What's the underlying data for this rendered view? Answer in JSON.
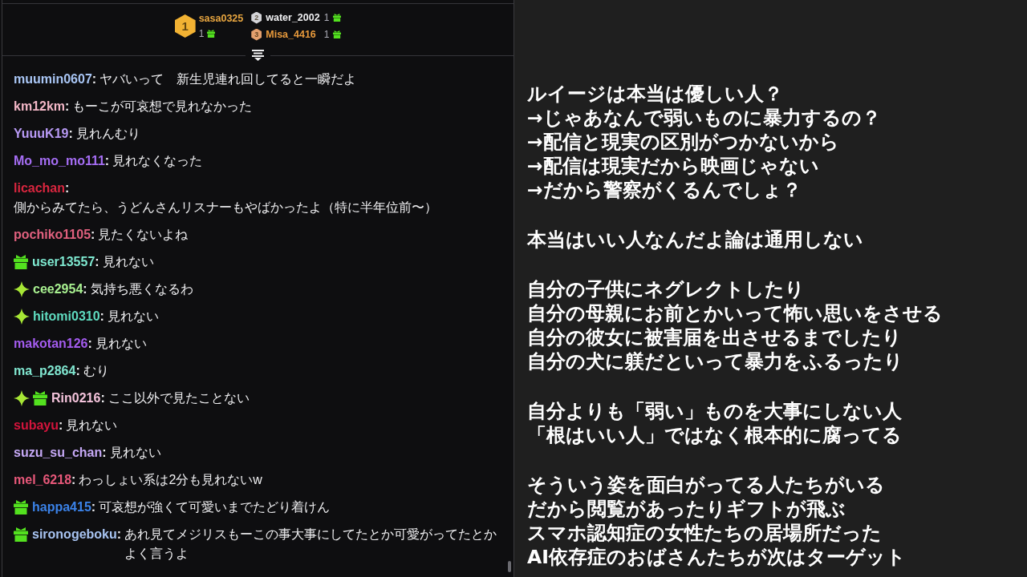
{
  "leaderboard": [
    {
      "kind": "featured",
      "medal": {
        "rank": "1",
        "color": "#f2b233"
      },
      "user": {
        "name": "sasa0325",
        "color": "#e8a640"
      },
      "count": "1"
    },
    {
      "kind": "compact",
      "medal": {
        "rank": "2",
        "color": "#d4d4d8"
      },
      "user": {
        "name": "water_2002",
        "color": "#efeff1"
      },
      "count": "1"
    },
    {
      "kind": "compact",
      "medal": {
        "rank": "3",
        "color": "#e3a06e"
      },
      "user": {
        "name": "Misa_4416",
        "color": "#e89a3c"
      },
      "count": "1"
    }
  ],
  "chat": [
    {
      "user": "muumin0607",
      "color": "#a9c6f5",
      "sep": ":",
      "kind": "inline",
      "message": "ヤバいって　新生児連れ回してると一瞬だよ"
    },
    {
      "user": "km12km",
      "color": "#f4b8c8",
      "sep": ":",
      "kind": "inline",
      "message": "もーこが可哀想で見れなかった"
    },
    {
      "user": "YuuuK19",
      "color": "#b89af5",
      "sep": ":",
      "kind": "inline",
      "message": "見れんむり"
    },
    {
      "user": "Mo_mo_mo111",
      "color": "#a66ef5",
      "sep": ":",
      "kind": "inline",
      "message": "見れなくなった"
    },
    {
      "user": "licachan",
      "color": "#d9263f",
      "sep": ":",
      "kind": "block",
      "message": "側からみてたら、うどんさんリスナーもやばかったよ（特に半年位前〜）"
    },
    {
      "user": "pochiko1105",
      "color": "#e0607e",
      "sep": ":",
      "kind": "inline",
      "message": "見たくないよね"
    },
    {
      "user": "user13557",
      "color": "#7ee8d0",
      "sep": ":",
      "kind": "inline",
      "badges": [
        {
          "kind": "gift"
        }
      ],
      "message": "見れない"
    },
    {
      "user": "cee2954",
      "color": "#a8f090",
      "sep": ":",
      "kind": "inline",
      "badges": [
        {
          "kind": "sparkle"
        }
      ],
      "message": "気持ち悪くなるわ"
    },
    {
      "user": "hitomi0310",
      "color": "#5fdcc0",
      "sep": ":",
      "kind": "inline",
      "badges": [
        {
          "kind": "sparkle"
        }
      ],
      "message": "見れない"
    },
    {
      "user": "makotan126",
      "color": "#a45cf0",
      "sep": ":",
      "kind": "inline",
      "message": "見れない"
    },
    {
      "user": "ma_p2864",
      "color": "#80e6d0",
      "sep": ":",
      "kind": "inline",
      "message": "むり"
    },
    {
      "user": "Rin0216",
      "color": "#f5c4dc",
      "sep": ":",
      "kind": "inline",
      "badges": [
        {
          "kind": "sparkle"
        },
        {
          "kind": "gift"
        }
      ],
      "message": "ここ以外で見たことない"
    },
    {
      "user": "subayu",
      "color": "#d4143c",
      "sep": ":",
      "kind": "inline",
      "message": "見れない"
    },
    {
      "user": "suzu_su_chan",
      "color": "#c5a8f5",
      "sep": ":",
      "kind": "inline",
      "message": "見れない"
    },
    {
      "user": "mel_6218",
      "color": "#e8587a",
      "sep": ":",
      "kind": "inline",
      "message": "わっしょい系は2分も見れないw"
    },
    {
      "user": "happa415",
      "color": "#3b82e8",
      "sep": ":",
      "kind": "inline",
      "badges": [
        {
          "kind": "gift"
        }
      ],
      "message": "可哀想が強くて可愛いまでたどり着けん"
    },
    {
      "user": "sironogeboku",
      "color": "#a8c4f2",
      "sep": ":",
      "kind": "inline",
      "badges": [
        {
          "kind": "gift"
        }
      ],
      "message": "あれ見てメジリスもーこの事大事にしてたとか可愛がってたとかよく言うよ"
    }
  ],
  "notes": {
    "paragraphs": [
      {
        "lines": [
          "ルイージは本当は優しい人？",
          "→じゃあなんで弱いものに暴力するの？",
          "→配信と現実の区別がつかないから",
          "→配信は現実だから映画じゃない",
          "→だから警察がくるんでしょ？"
        ]
      },
      {
        "lines": [
          "本当はいい人なんだよ論は通用しない"
        ]
      },
      {
        "lines": [
          "自分の子供にネグレクトしたり",
          "自分の母親にお前とかいって怖い思いをさせる",
          "自分の彼女に被害届を出させるまでしたり",
          "自分の犬に躾だといって暴力をふるったり"
        ]
      },
      {
        "lines": [
          "自分よりも「弱い」ものを大事にしない人",
          "「根はいい人」ではなく根本的に腐ってる"
        ]
      },
      {
        "lines": [
          "そういう姿を面白がってる人たちがいる",
          "だから閲覧があったりギフトが飛ぶ",
          "スマホ認知症の女性たちの居場所だった",
          "AI依存症のおばさんたちが次はターゲット"
        ]
      }
    ]
  }
}
